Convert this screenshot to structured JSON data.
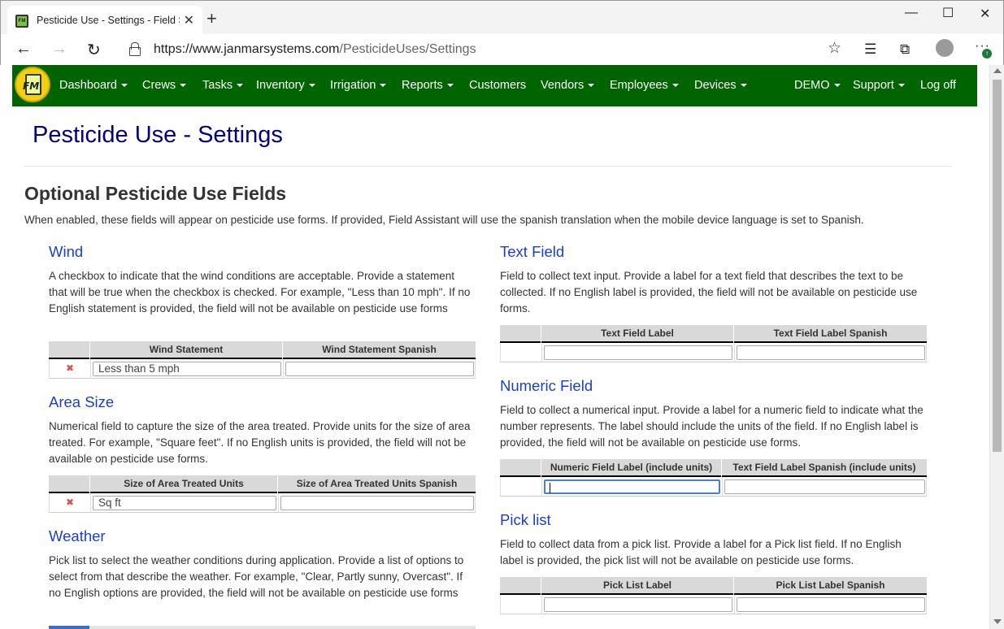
{
  "browser": {
    "tab_title": "Pesticide Use - Settings - Field Se",
    "url_host": "https://www.janmarsystems.com",
    "url_path": "/PesticideUses/Settings"
  },
  "navbar": {
    "logo_text": "FM",
    "items": [
      {
        "label": "Dashboard"
      },
      {
        "label": "Crews"
      },
      {
        "label": "Tasks"
      },
      {
        "label": "Inventory"
      },
      {
        "label": "Irrigation"
      },
      {
        "label": "Reports"
      },
      {
        "label": "Customers"
      },
      {
        "label": "Vendors"
      },
      {
        "label": "Employees"
      },
      {
        "label": "Devices"
      }
    ],
    "right_items": [
      {
        "label": "DEMO"
      },
      {
        "label": "Support"
      },
      {
        "label": "Log off"
      }
    ]
  },
  "page": {
    "title": "Pesticide Use - Settings",
    "section_title": "Optional Pesticide Use Fields",
    "section_desc": "When enabled, these fields will appear on pesticide use forms. If provided, Field Assistant will use the spanish translation when the mobile device language is set to Spanish."
  },
  "fields": {
    "wind": {
      "title": "Wind",
      "desc": "A checkbox to indicate that the wind conditions are acceptable. Provide a statement that will be true when the checkbox is checked. For example, \"Less than 10 mph\". If no English statement is provided, the field will not be available on pesticide use forms",
      "col1": "Wind Statement",
      "col2": "Wind Statement Spanish",
      "value1": "Less than 5 mph",
      "value2": ""
    },
    "area": {
      "title": "Area Size",
      "desc": "Numerical field to capture the size of the area treated. Provide units for the size of area treated. For example, \"Square feet\". If no English units is provided, the field will not be available on pesticide use forms.",
      "col1": "Size of Area Treated Units",
      "col2": "Size of Area Treated Units Spanish",
      "value1": "Sq ft",
      "value2": ""
    },
    "weather": {
      "title": "Weather",
      "desc": "Pick list to select the weather conditions during application. Provide a list of options to select from that describe the weather. For example, \"Clear, Partly sunny, Overcast\". If no English options are provided, the field will not be available on pesticide use forms"
    },
    "text": {
      "title": "Text Field",
      "desc": "Field to collect text input. Provide a label for a text field that describes the text to be collected. If no English label is provided, the field will not be available on pesticide use forms.",
      "col1": "Text Field Label",
      "col2": "Text Field Label Spanish",
      "value1": "",
      "value2": ""
    },
    "numeric": {
      "title": "Numeric Field",
      "desc": "Field to collect a numerical input. Provide a label for a numeric field to indicate what the number represents. The label should include the units of the field. If no English label is provided, the field will not be available on pesticide use forms.",
      "col1": "Numeric Field Label (include units)",
      "col2": "Text Field Label Spanish (include units)",
      "value1": "",
      "value2": ""
    },
    "picklist": {
      "title": "Pick list",
      "desc": "Field to collect data from a pick list. Provide a label for a Pick list field. If no English label is provided, the pick list will not be available on pesticide use forms.",
      "col1": "Pick List Label",
      "col2": "Pick List Label Spanish",
      "value1": "",
      "value2": ""
    }
  },
  "icons": {
    "delete": "✖"
  },
  "colors": {
    "navbar": "#006400",
    "title": "#000080",
    "field_title": "#1a3fd0",
    "delete": "#d9534f"
  }
}
